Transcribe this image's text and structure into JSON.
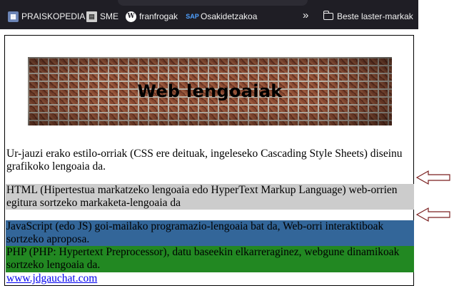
{
  "bookmarks": {
    "items": [
      {
        "label": "PRAISKOPEDIA",
        "icon": "praiskopedia-icon"
      },
      {
        "label": "SME",
        "icon": "sme-icon"
      },
      {
        "label": "franfrogak",
        "icon": "wordpress-icon"
      },
      {
        "label": "Osakidetzakoa",
        "icon": "sap-icon"
      }
    ],
    "overflow_icon": "chevron-double-right-icon",
    "folder": {
      "label": "Beste laster-markak",
      "icon": "folder-icon"
    }
  },
  "banner": {
    "title": "Web lengoaiak",
    "background": "brick-wall"
  },
  "paragraphs": {
    "css": "Ur-jauzi erako estilo-orriak (CSS ere deituak, ingeleseko Cascading Style Sheets) diseinu grafikoko lengoaia da.",
    "html": "HTML (Hipertestua markatzeko lengoaia edo HyperText Markup Language) web-orrien egitura sortzeko markaketa-lengoaia da",
    "js": "JavaScript (edo JS) goi-mailako programazio-lengoaia bat da, Web-orri interaktiboak sortzeko aproposa.",
    "php": "PHP (PHP: Hypertext Preprocessor), datu baseekin elkarreraginez, webgune dinamikoak sortzeko lengoaia da."
  },
  "link": {
    "text": "www.jdgauchat.com"
  },
  "colors": {
    "bookmarks_bg": "#1f1e25",
    "html_bg": "#cccccc",
    "js_bg": "#336699",
    "php_bg": "#228822",
    "link": "#0000ee",
    "arrow_stroke": "#7a1f1f"
  }
}
